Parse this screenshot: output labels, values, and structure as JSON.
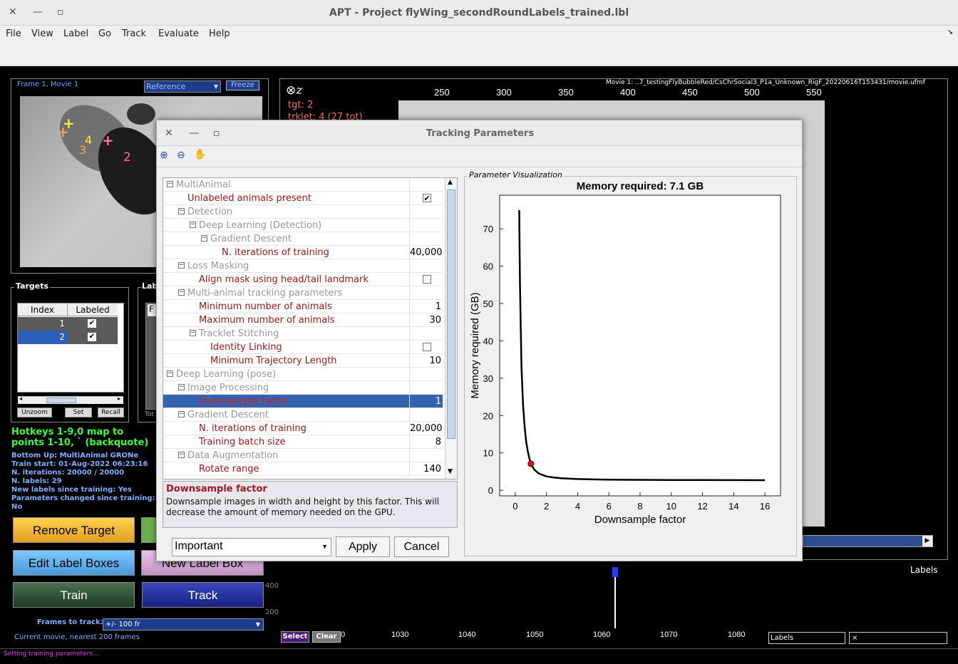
{
  "window": {
    "title": "APT - Project flyWing_secondRoundLabels_trained.lbl"
  },
  "menu": [
    "File",
    "View",
    "Label",
    "Go",
    "Track",
    "Evaluate",
    "Help"
  ],
  "left": {
    "frame_label": "Frame 1, Movie 1",
    "reference_select": "Reference",
    "freeze_label": "Freeze",
    "targets_title": "Targets",
    "labels_title": "Lab",
    "targets_headers": [
      "Index",
      "Labeled"
    ],
    "targets_rows": [
      {
        "index": "1",
        "labeled": "✔"
      },
      {
        "index": "2",
        "labeled": "✔"
      }
    ],
    "unzoom": "Unzoom",
    "set": "Set",
    "recall": "Recall",
    "labels_col": "F",
    "labels_tot": "Tot",
    "hotkeys": "Hotkeys 1-9,0 map to points 1-10, ` (backquote)",
    "info": [
      "Bottom Up: MultiAnimal GRONe",
      "Train start: 01-Aug-2022 06:23:16",
      "N. iterations: 20000 / 20000",
      "N. labels: 29",
      "New labels since training: Yes",
      "Parameters changed since training: No"
    ],
    "remove_target": "Remove Target",
    "edit_label_boxes": "Edit Label Boxes",
    "new_label_box": "New Label Box",
    "train": "Train",
    "track": "Track",
    "frames_to_track_label": "Frames to track:",
    "frames_to_track_value": "+/- 100 fr",
    "current_movie": "Current movie, nearest 200 frames",
    "keypoints": [
      "3",
      "4",
      "2"
    ]
  },
  "main": {
    "movie_path": "Movie 1: ..7_testingFlyBubbleRed/CsChrSocial3_P1a_Unknown_RigF_20220616T153431/movie.ufmf",
    "x_ticks": [
      "250",
      "300",
      "350",
      "400",
      "450",
      "500",
      "550"
    ],
    "tgt": "tgt: 2",
    "trklet": "trklet: 4 (27 tot)",
    "labels_caption": "Labels"
  },
  "timeline": {
    "y_ticks": [
      "400",
      "200"
    ],
    "x_ticks": [
      "0",
      "1030",
      "1040",
      "1050",
      "1060",
      "1070",
      "1080"
    ],
    "select": "Select",
    "clear": "Clear",
    "labels_field": "Labels",
    "close_field": "×"
  },
  "status": "Setting training parameters...",
  "dialog": {
    "title": "Tracking Parameters",
    "tree": [
      {
        "label": "MultiAnimal",
        "indent": 0,
        "type": "group",
        "toggle": "−"
      },
      {
        "label": "Unlabeled animals present",
        "indent": 1,
        "type": "param",
        "check": true
      },
      {
        "label": "Detection",
        "indent": 1,
        "type": "group",
        "toggle": "−"
      },
      {
        "label": "Deep Learning (Detection)",
        "indent": 2,
        "type": "group",
        "toggle": "−"
      },
      {
        "label": "Gradient Descent",
        "indent": 3,
        "type": "group",
        "toggle": "−"
      },
      {
        "label": "N. iterations of training",
        "indent": 4,
        "type": "param",
        "value": "40,000"
      },
      {
        "label": "Loss Masking",
        "indent": 1,
        "type": "group",
        "toggle": "−"
      },
      {
        "label": "Align mask using head/tail landmark",
        "indent": 2,
        "type": "param",
        "check": false
      },
      {
        "label": "Multi-animal tracking parameters",
        "indent": 1,
        "type": "group",
        "toggle": "−"
      },
      {
        "label": "Minimum number of animals",
        "indent": 2,
        "type": "param",
        "value": "1"
      },
      {
        "label": "Maximum number of animals",
        "indent": 2,
        "type": "param",
        "value": "30"
      },
      {
        "label": "Tracklet Stitching",
        "indent": 2,
        "type": "group",
        "toggle": "−"
      },
      {
        "label": "Identity Linking",
        "indent": 3,
        "type": "param",
        "check": false
      },
      {
        "label": "Minimum Trajectory Length",
        "indent": 3,
        "type": "param",
        "value": "10"
      },
      {
        "label": "Deep Learning (pose)",
        "indent": 0,
        "type": "group",
        "toggle": "−"
      },
      {
        "label": "Image Processing",
        "indent": 1,
        "type": "group",
        "toggle": "−"
      },
      {
        "label": "Downsample factor",
        "indent": 2,
        "type": "param",
        "value": "1",
        "selected": true
      },
      {
        "label": "Gradient Descent",
        "indent": 1,
        "type": "group",
        "toggle": "−"
      },
      {
        "label": "N. iterations of training",
        "indent": 2,
        "type": "param",
        "value": "20,000"
      },
      {
        "label": "Training batch size",
        "indent": 2,
        "type": "param",
        "value": "8"
      },
      {
        "label": "Data Augmentation",
        "indent": 1,
        "type": "group",
        "toggle": "−"
      },
      {
        "label": "Rotate range",
        "indent": 2,
        "type": "param",
        "value": "140"
      }
    ],
    "desc_title": "Downsample factor",
    "desc_text": "Downsample images in width and height by this factor. This will decrease the amount of memory needed on the GPU.",
    "level_select": "Important",
    "apply": "Apply",
    "cancel": "Cancel",
    "viz_title": "Parameter Visualization"
  },
  "chart_data": {
    "type": "line",
    "title": "Memory required: 7.1 GB",
    "xlabel": "Downsample factor",
    "ylabel": "Memory required (GB)",
    "xlim": [
      -1,
      17
    ],
    "ylim": [
      -1.5,
      79
    ],
    "xticks": [
      0,
      2,
      4,
      6,
      8,
      10,
      12,
      14,
      16
    ],
    "yticks": [
      0,
      10,
      20,
      30,
      40,
      50,
      60,
      70
    ],
    "series": [
      {
        "x": [
          0.25,
          0.3,
          0.4,
          0.5,
          0.6,
          0.7,
          0.8,
          0.9,
          1.0,
          1.2,
          1.5,
          2,
          2.5,
          3,
          4,
          5,
          6,
          8,
          10,
          12,
          14,
          16
        ],
        "y": [
          75,
          55,
          33,
          23,
          17,
          13,
          10.5,
          8.6,
          7.1,
          5.6,
          4.5,
          3.7,
          3.4,
          3.2,
          3.0,
          2.9,
          2.85,
          2.8,
          2.75,
          2.75,
          2.72,
          2.7
        ]
      }
    ],
    "highlight": {
      "x": 1,
      "y": 7.1
    },
    "grid": false,
    "line_color": "#000000",
    "marker_color": "#e01010"
  }
}
